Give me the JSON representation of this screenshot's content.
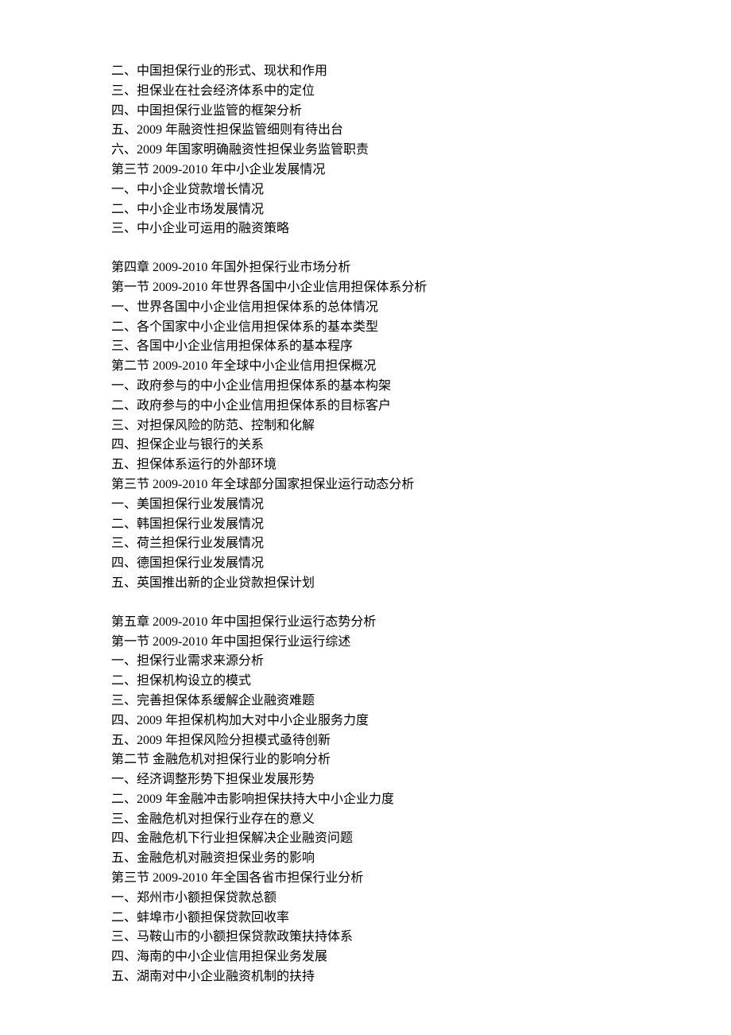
{
  "lines": [
    "二、中国担保行业的形式、现状和作用",
    "三、担保业在社会经济体系中的定位",
    "四、中国担保行业监管的框架分析",
    "五、2009 年融资性担保监管细则有待出台",
    "六、2009 年国家明确融资性担保业务监管职责",
    "第三节  2009-2010 年中小企业发展情况",
    "一、中小企业贷款增长情况",
    "二、中小企业市场发展情况",
    "三、中小企业可运用的融资策略",
    "",
    "第四章  2009-2010 年国外担保行业市场分析",
    "第一节  2009-2010 年世界各国中小企业信用担保体系分析",
    "一、世界各国中小企业信用担保体系的总体情况",
    "二、各个国家中小企业信用担保体系的基本类型",
    "三、各国中小企业信用担保体系的基本程序",
    "第二节 2009-2010 年全球中小企业信用担保概况",
    "一、政府参与的中小企业信用担保体系的基本构架",
    "二、政府参与的中小企业信用担保体系的目标客户",
    "三、对担保风险的防范、控制和化解",
    "四、担保企业与银行的关系",
    "五、担保体系运行的外部环境",
    "第三节 2009-2010 年全球部分国家担保业运行动态分析",
    "一、美国担保行业发展情况",
    "二、韩国担保行业发展情况",
    "三、荷兰担保行业发展情况",
    "四、德国担保行业发展情况",
    "五、英国推出新的企业贷款担保计划",
    "",
    "第五章  2009-2010 年中国担保行业运行态势分析",
    "第一节  2009-2010 年中国担保行业运行综述",
    "一、担保行业需求来源分析",
    "二、担保机构设立的模式",
    "三、完善担保体系缓解企业融资难题",
    "四、2009 年担保机构加大对中小企业服务力度",
    "五、2009 年担保风险分担模式亟待创新",
    "第二节  金融危机对担保行业的影响分析",
    "一、经济调整形势下担保业发展形势",
    "二、2009 年金融冲击影响担保扶持大中小企业力度",
    "三、金融危机对担保行业存在的意义",
    "四、金融危机下行业担保解决企业融资问题",
    "五、金融危机对融资担保业务的影响",
    "第三节  2009-2010 年全国各省市担保行业分析",
    "一、郑州市小额担保贷款总额",
    "二、蚌埠市小额担保贷款回收率",
    "三、马鞍山市的小额担保贷款政策扶持体系",
    "四、海南的中小企业信用担保业务发展",
    "五、湖南对中小企业融资机制的扶持"
  ]
}
